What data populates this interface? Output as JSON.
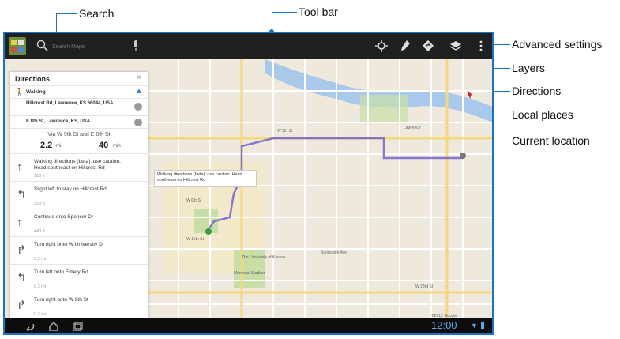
{
  "callouts": {
    "search": "Search",
    "toolbar": "Tool bar",
    "advanced": "Advanced settings",
    "layers": "Layers",
    "directions": "Directions",
    "local": "Local places",
    "current": "Current location"
  },
  "toolbar": {
    "search_placeholder": "Search Maps"
  },
  "panel": {
    "title": "Directions",
    "close": "×",
    "mode": "Walking",
    "from": "Hillcrest Rd, Lawrence, KS 66044, USA",
    "to": "E 8th St, Lawrence, KS, USA",
    "via": "Via W 9th St and E 8th St",
    "distance": "2.2",
    "distance_unit": "mi",
    "time": "40",
    "time_unit": "min",
    "steps": [
      {
        "text": "Walking directions (beta): use caution. Head southeast on Hillcrest Rd",
        "dist": "150 ft"
      },
      {
        "text": "Slight left to stay on Hillcrest Rd",
        "dist": "390 ft"
      },
      {
        "text": "Continue onto Spencer Dr",
        "dist": "440 ft"
      },
      {
        "text": "Turn right onto W University Dr",
        "dist": "0.2 mi"
      },
      {
        "text": "Turn left onto Emery Rd",
        "dist": "0.3 mi"
      },
      {
        "text": "Turn right onto W 9th St",
        "dist": "0.3 mi"
      }
    ]
  },
  "map": {
    "bubble": "Walking directions (beta): use caution. Head southeast on Hillcrest Rd",
    "labels": {
      "lawrence": "Lawrence",
      "w6": "W 6th St",
      "w9": "W 9th St",
      "w15": "W 15th St",
      "w23": "W 23rd St",
      "university": "The University of Kansas",
      "sunnyside": "Sunnyside Ave",
      "stadium": "Memorial Stadium",
      "copyright": "©2012 Google"
    }
  },
  "statusbar": {
    "time": "12:00"
  },
  "colors": {
    "accent": "#1a73c9",
    "route": "#6a5acd",
    "water": "#a9c9ea",
    "park": "#c7dfa7"
  }
}
